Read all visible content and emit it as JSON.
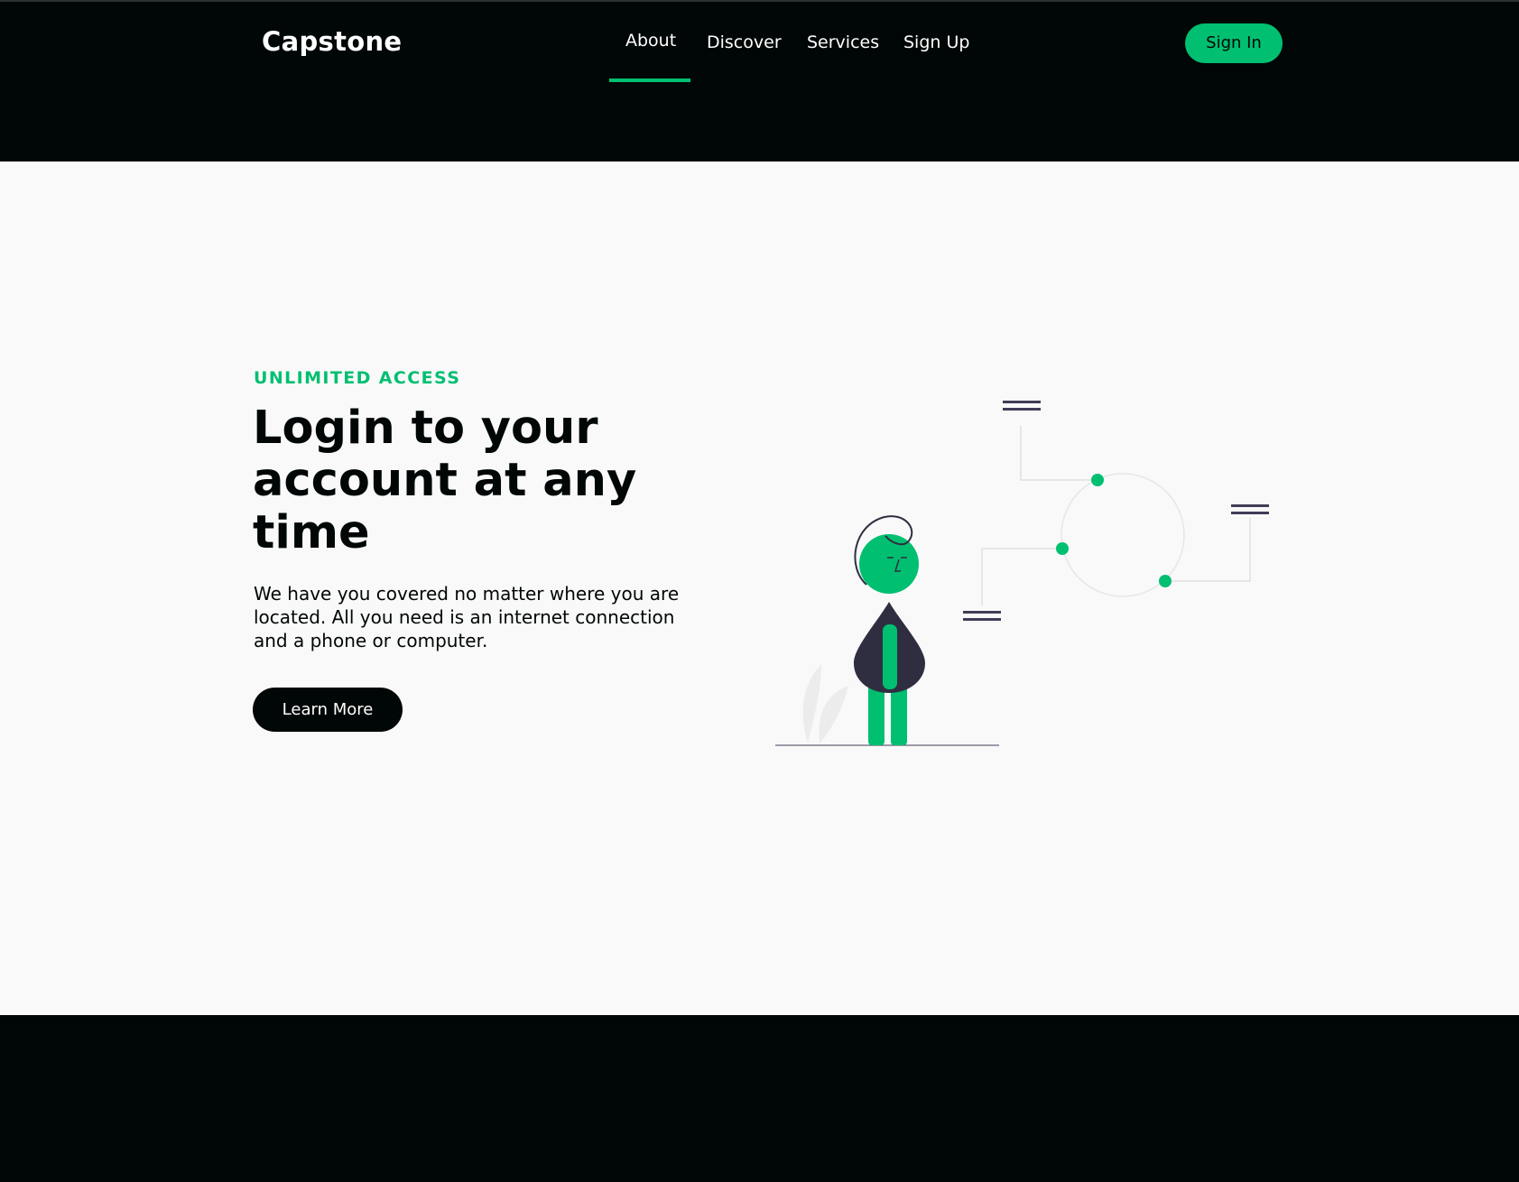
{
  "header": {
    "logo": "Capstone",
    "nav": [
      {
        "label": "About",
        "active": true
      },
      {
        "label": "Discover"
      },
      {
        "label": "Services"
      },
      {
        "label": "Sign Up"
      }
    ],
    "signin_label": "Sign In"
  },
  "hero": {
    "eyebrow": "UNLIMITED ACCESS",
    "headline": "Login to your account at any time",
    "description": "We have you covered no matter where you are located. All you need is an internet connection and a phone or computer.",
    "button_label": "Learn More"
  },
  "colors": {
    "accent": "#01bf71",
    "dark": "#010606",
    "light": "#f9f9f9"
  }
}
